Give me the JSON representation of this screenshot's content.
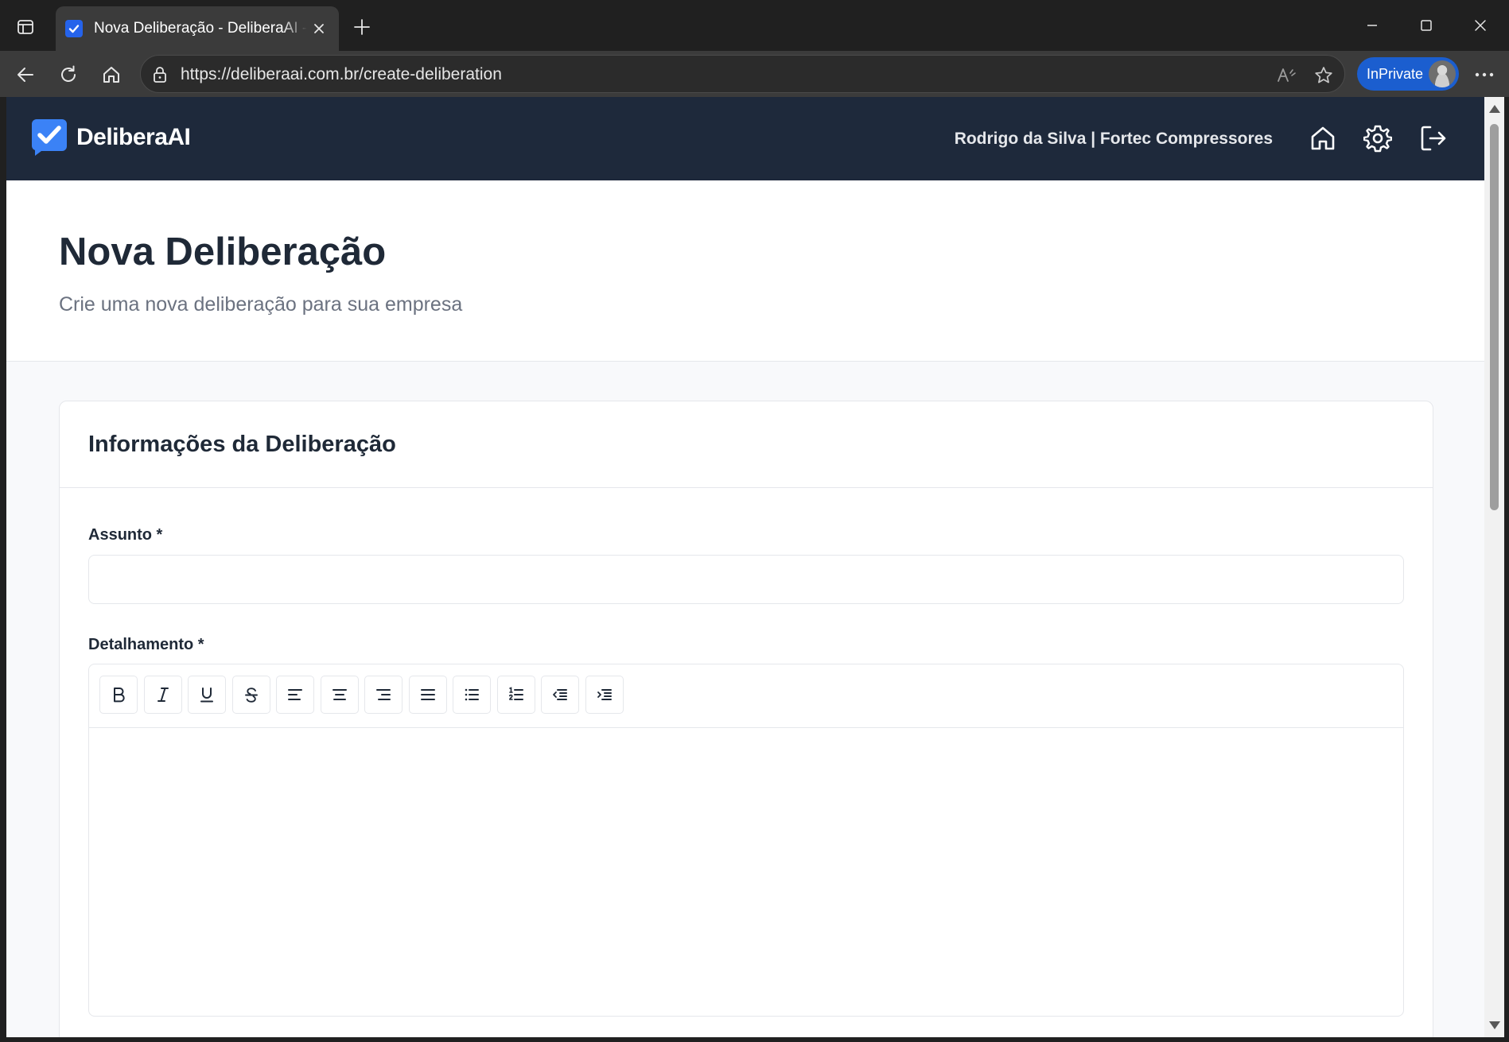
{
  "browser": {
    "tab_title": "Nova Deliberação - DeliberaAI - Deliberação",
    "url": "https://deliberaai.com.br/create-deliberation",
    "inprivate_label": "InPrivate",
    "accent_color": "#1b5ecf"
  },
  "app": {
    "brand": "DeliberaAI",
    "user_info": "Rodrigo da Silva | Fortec Compressores",
    "header_color": "#1e293b",
    "brand_color": "#2563eb",
    "header_icons": [
      "home-icon",
      "settings-icon",
      "logout-icon"
    ]
  },
  "page": {
    "title": "Nova Deliberação",
    "subtitle": "Crie uma nova deliberação para sua empresa"
  },
  "form": {
    "card_title": "Informações da Deliberação",
    "subject_label": "Assunto *",
    "subject_value": "",
    "details_label": "Detalhamento *",
    "details_value": "",
    "toolbar_buttons": [
      "bold",
      "italic",
      "underline",
      "strikethrough",
      "align-left",
      "align-center",
      "align-right",
      "align-justify",
      "bullet-list",
      "ordered-list",
      "outdent",
      "indent"
    ]
  }
}
